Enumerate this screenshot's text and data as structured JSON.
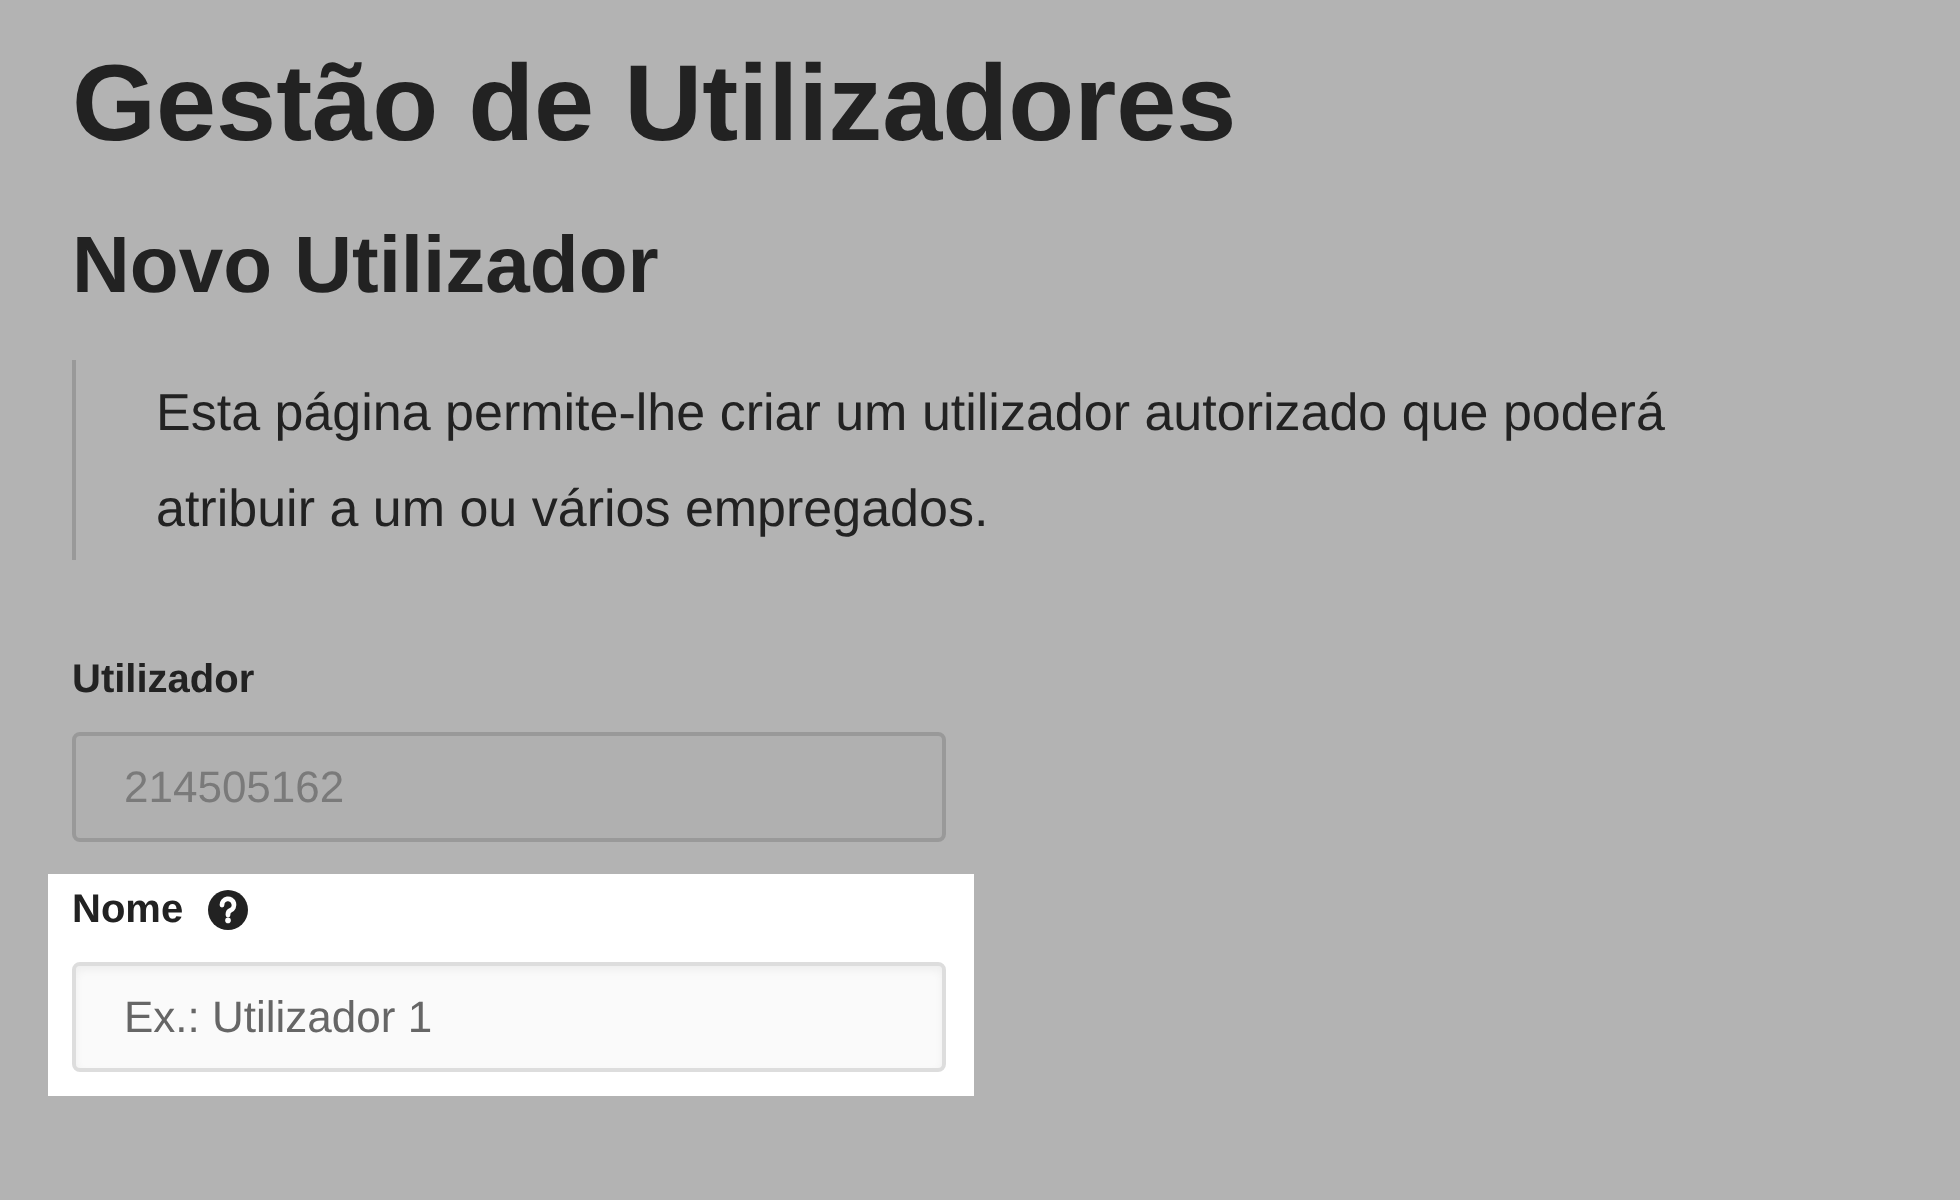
{
  "title": "Gestão de Utilizadores",
  "subtitle": "Novo Utilizador",
  "description": "Esta página permite-lhe criar um utilizador autorizado que poderá atribuir a um ou vários empregados.",
  "fields": [
    {
      "label": "Utilizador",
      "value": "214505162",
      "disabled": true,
      "help": false,
      "highlighted": false
    },
    {
      "label": "Nome",
      "placeholder": "Ex.: Utilizador 1",
      "disabled": false,
      "help": true,
      "highlighted": true
    }
  ]
}
